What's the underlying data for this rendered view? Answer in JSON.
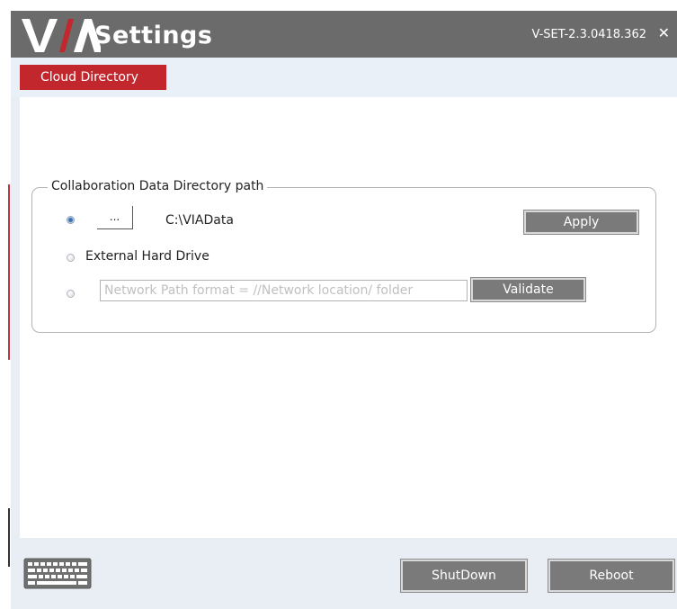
{
  "app": {
    "logo_text": "VIA",
    "title": "Settings",
    "version": "V-SET-2.3.0418.362",
    "close_symbol": "✕"
  },
  "tabs": [
    {
      "label": "Cloud Directory",
      "active": true
    }
  ],
  "collab_directory": {
    "legend": "Collaboration Data Directory path",
    "options": [
      {
        "id": "local",
        "checked": true,
        "browse_label": "...",
        "value": "C:\\VIAData"
      },
      {
        "id": "external",
        "checked": false,
        "label": "External Hard Drive"
      },
      {
        "id": "network",
        "checked": false,
        "placeholder": "Network Path format = //Network location/ folder",
        "value": ""
      }
    ],
    "apply_label": "Apply",
    "validate_label": "Validate"
  },
  "footer": {
    "keyboard_icon": "keyboard-icon",
    "shutdown_label": "ShutDown",
    "reboot_label": "Reboot"
  },
  "colors": {
    "titlebar": "#6b6b6b",
    "accent_red": "#c1272d",
    "button_gray": "#7a7a7a"
  }
}
